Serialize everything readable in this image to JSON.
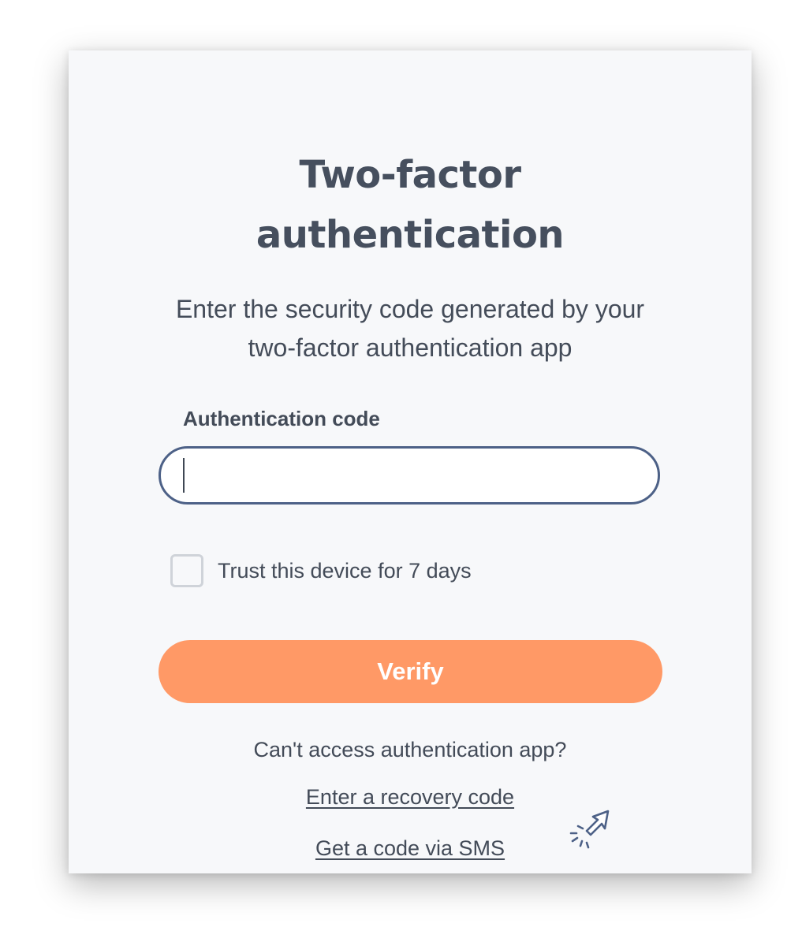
{
  "title": {
    "line1": "Two-factor",
    "line2": "authentication"
  },
  "subtitle": {
    "line1": "Enter the security code generated by your",
    "line2": "two-factor authentication app"
  },
  "code_field": {
    "label": "Authentication code",
    "value": "",
    "placeholder": ""
  },
  "trust_device": {
    "label": "Trust this device for 7 days",
    "checked": false
  },
  "verify_button": {
    "label": "Verify",
    "color": "#ff9966"
  },
  "help": {
    "question": "Can't access authentication app?",
    "recovery_link": "Enter a recovery code",
    "sms_link": "Get a code via SMS"
  },
  "icons": {
    "pointer": "click-pointer-icon"
  }
}
